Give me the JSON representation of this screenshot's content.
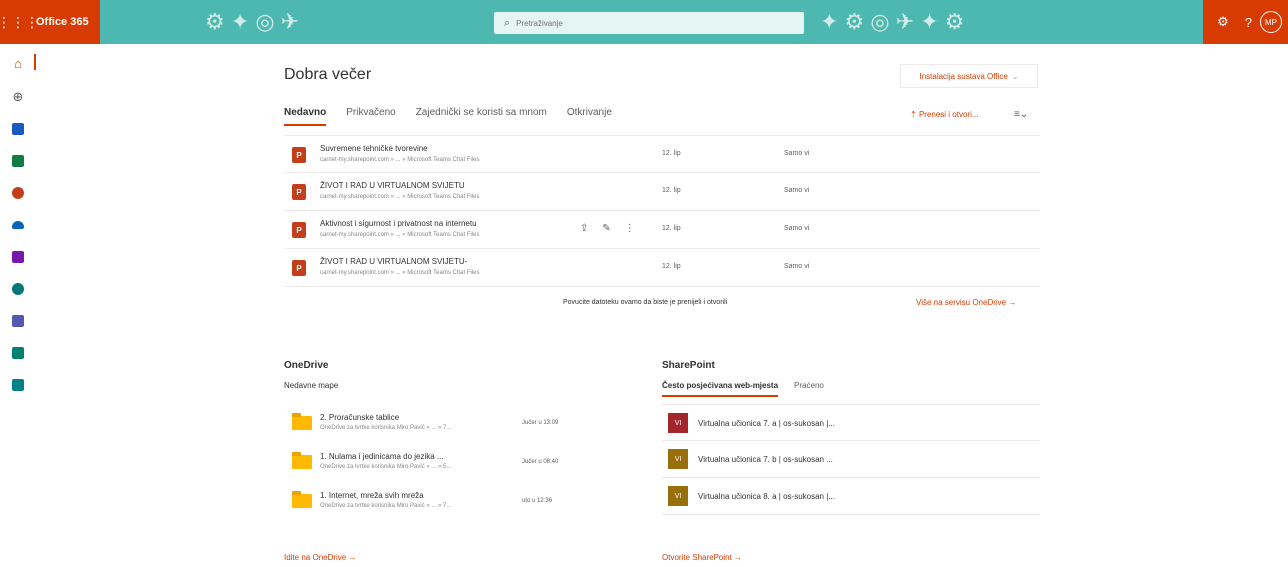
{
  "topbar": {
    "waffle": "⋮⋮⋮",
    "brand": "Office 365",
    "search_placeholder": "Pretraživanje",
    "settings_icon": "⚙",
    "help_icon": "?",
    "avatar_initials": "MP",
    "brand_color": "#d83b01",
    "banner_color": "#4db8b0"
  },
  "rail": [
    {
      "name": "home",
      "color": "#d83b01"
    },
    {
      "name": "create",
      "color": "#605e5c"
    },
    {
      "name": "word",
      "color": "#185abd"
    },
    {
      "name": "excel",
      "color": "#107c41"
    },
    {
      "name": "powerpoint",
      "color": "#c43e1c"
    },
    {
      "name": "onedrive",
      "color": "#0364b8"
    },
    {
      "name": "onenote",
      "color": "#7719aa"
    },
    {
      "name": "sharepoint",
      "color": "#03787c"
    },
    {
      "name": "teams",
      "color": "#5558af"
    },
    {
      "name": "sway",
      "color": "#008272"
    },
    {
      "name": "admin",
      "color": "#038387"
    }
  ],
  "main": {
    "greeting": "Dobra večer",
    "install_label": "Instalacija sustava Office",
    "install_chevron": "⌄",
    "tabs": [
      "Nedavno",
      "Prikvačeno",
      "Zajednički se koristi sa mnom",
      "Otkrivanje"
    ],
    "upload_label": "Prenesi i otvori...",
    "sort_icon": "≡⌄"
  },
  "files": [
    {
      "name": "Suvremene tehničke tvorevine",
      "path": "carnet-my.sharepoint.com » ... » Microsoft Teams Chat Files",
      "date": "12. lip",
      "share": "Samo vi"
    },
    {
      "name": "ŽIVOT I RAD U VIRTUALNOM SVIJETU",
      "path": "carnet-my.sharepoint.com » ... » Microsoft Teams Chat Files",
      "date": "12. lip",
      "share": "Samo vi"
    },
    {
      "name": "Aktivnost i sigurnost i privatnost na internetu",
      "path": "carnet-my.sharepoint.com » ... » Microsoft Teams Chat Files",
      "date": "12. lip",
      "share": "Samo vi"
    },
    {
      "name": "ŽIVOT I RAD U VIRTUALNOM SVIJETU-",
      "path": "carnet-my.sharepoint.com » ... » Microsoft Teams Chat Files",
      "date": "12. lip",
      "share": "Samo vi"
    }
  ],
  "file_icon_letter": "P",
  "file_actions": {
    "share": "⇪",
    "pin": "✎",
    "more": "⋮"
  },
  "drop_hint": "Povucite datoteku ovamo da biste je prenijeli i otvorili",
  "more_onedrive": "Više na servisu OneDrive →",
  "onedrive": {
    "title": "OneDrive",
    "tab": "Nedavne mape",
    "folders": [
      {
        "name": "2. Proračunske tablice",
        "path": "OneDrive za tvrtke korisnika Miro Pavić » ... » 7...",
        "date": "Jučer u 13:09"
      },
      {
        "name": "1. Nulama i jedinicama do jezika ...",
        "path": "OneDrive za tvrtke korisnika Miro Pavić » ... » 5...",
        "date": "Jučer u 08:40"
      },
      {
        "name": "1. Internet, mreža svih mreža",
        "path": "OneDrive za tvrtke korisnika Miro Pavić » ... » 7...",
        "date": "uto u 12:36"
      }
    ],
    "link": "Idite na OneDrive →"
  },
  "sharepoint": {
    "title": "SharePoint",
    "tabs": [
      "Često posjećivana web-mjesta",
      "Praćeno"
    ],
    "sites": [
      {
        "tile": "VI",
        "name": "Virtualna učionica 7. a | os-sukosan |...",
        "color": "#a4262c"
      },
      {
        "tile": "VI",
        "name": "Virtualna učionica 7. b | os-sukosan ...",
        "color": "#986f0b"
      },
      {
        "tile": "VI",
        "name": "Virtualna učionica 8. a | os-sukosan |...",
        "color": "#986f0b"
      }
    ],
    "link": "Otvorite SharePoint →"
  }
}
